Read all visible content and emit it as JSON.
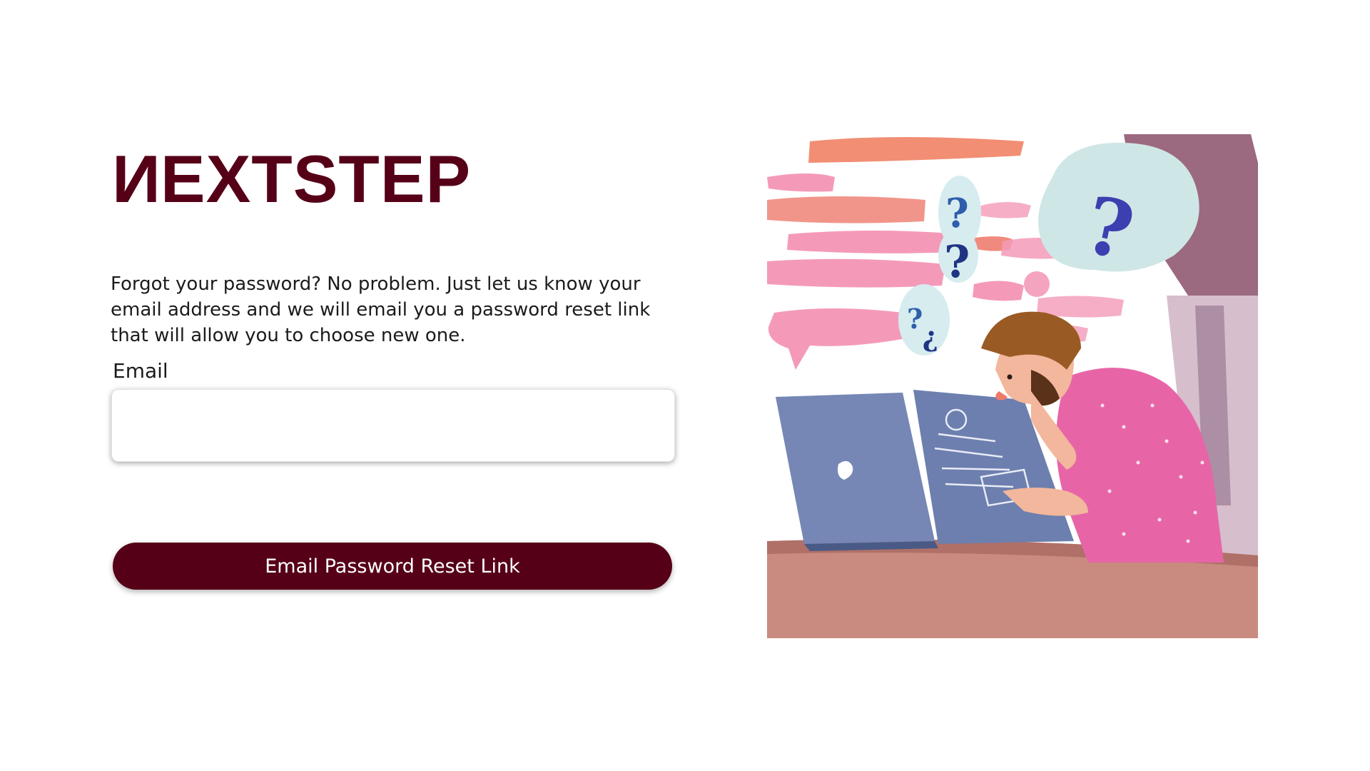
{
  "brand": {
    "logo_first": "N",
    "logo_rest": "EXTSTEP",
    "color": "#560018"
  },
  "form": {
    "intro_text": "Forgot your password? No problem. Just let us know your email address and we will email you a password reset link that will allow you to choose new one.",
    "email_label": "Email",
    "email_value": "",
    "email_placeholder": "",
    "submit_label": "Email Password Reset Link"
  },
  "illustration": {
    "subject": "confused-person-at-laptop-icon"
  },
  "colors": {
    "accent": "#560018",
    "background": "#ffffff",
    "text": "#1b1b1b"
  }
}
